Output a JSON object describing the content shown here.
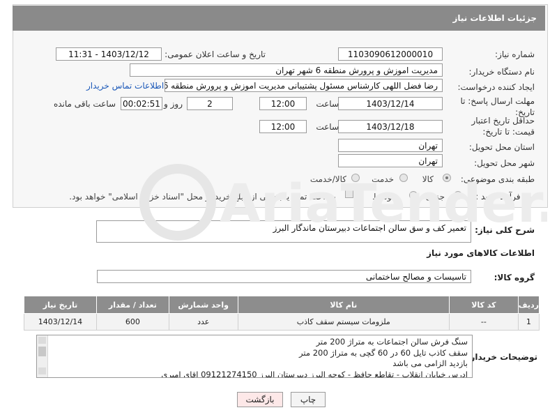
{
  "header": {
    "title": "جزئیات اطلاعات نیاز"
  },
  "form": {
    "need_number_label": "شماره نیاز:",
    "need_number": "1103090612000010",
    "announce_label": "تاریخ و ساعت اعلان عمومی:",
    "announce_value": "1403/12/12 - 11:31",
    "buyer_org_label": "نام دستگاه خریدار:",
    "buyer_org": "مدیریت اموزش و پرورش منطقه 6 شهر تهران",
    "creator_label": "ایجاد کننده درخواست:",
    "creator": "رضا فضل اللهی کارشناس مسئول پشتیبانی  مدیریت اموزش و پرورش منطقه 6 شهر تهران",
    "contact_link": "اطلاعات تماس خریدار",
    "deadline_label": "مهلت ارسال پاسخ: تا تاریخ:",
    "deadline_date": "1403/12/14",
    "time_label": "ساعت",
    "deadline_time": "12:00",
    "days_value": "2",
    "days_label": "روز و",
    "remaining_time": "00:02:51",
    "remaining_label": "ساعت باقی مانده",
    "validity_label": "حداقل تاریخ اعتبار قیمت: تا تاریخ:",
    "validity_date": "1403/12/18",
    "validity_time": "12:00",
    "province_label": "استان محل تحویل:",
    "province": "تهران",
    "city_label": "شهر محل تحویل:",
    "city": "تهران",
    "category_label": "طبقه بندی موضوعی:",
    "category_options": [
      "کالا",
      "خدمت",
      "کالا/خدمت"
    ],
    "process_label": "نوع فرآیند خرید :",
    "process_options": [
      "جزیی",
      "متوسط"
    ],
    "payment_note": "پرداخت تمام یا بخشی از مبلغ خرید،از محل \"اسناد خزانه اسلامی\" خواهد بود."
  },
  "description": {
    "label": "شرح کلی نیاز:",
    "value": "تعمیر کف و سق سالن اجتماعات دبیرستان ماندگار البرز"
  },
  "items_section": {
    "title": "اطلاعات کالاهای مورد نیاز",
    "group_label": "گروه کالا:",
    "group_value": "تاسیسات و مصالح ساختمانی"
  },
  "table": {
    "headers": [
      "ردیف",
      "کد کالا",
      "نام کالا",
      "واحد شمارش",
      "تعداد / مقدار",
      "تاریخ نیاز"
    ],
    "rows": [
      [
        "1",
        "--",
        "ملزومات سیستم سقف کاذب",
        "عدد",
        "600",
        "1403/12/14"
      ]
    ]
  },
  "buyer_notes": {
    "label": "توضیحات خریدار:",
    "lines": [
      "سنگ فرش سالن اجتماعات به متراژ 200 متر",
      "سقف کاذب تایل 60 در 60 گچی  به متراژ 200 متر",
      "بازدید الزامی می باشد",
      "ادرس خیابان انقلاب - تقاطع حافظ - کوچه البرز دبیرستان البرز 09121274150 اقای امیری"
    ]
  },
  "buttons": {
    "print": "چاپ",
    "back": "بازگشت"
  },
  "watermark": {
    "text": "AriaTender.net"
  },
  "colors": {
    "header_bg": "#8a8a8a",
    "link": "#1b58b8",
    "back_btn_bg": "#fde8e8"
  }
}
